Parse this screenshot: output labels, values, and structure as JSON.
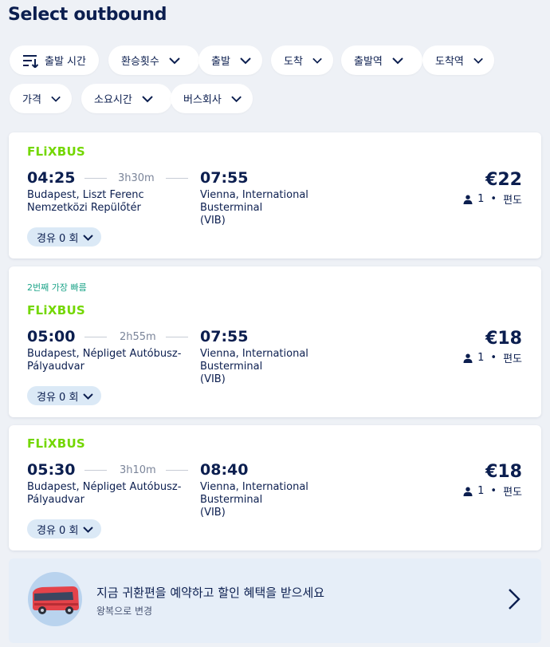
{
  "header": {
    "title": "Select outbound"
  },
  "filters": [
    {
      "label": "출발 시간"
    },
    {
      "label": "환승횟수"
    },
    {
      "label": "출발"
    },
    {
      "label": "도착"
    },
    {
      "label": "출발역"
    },
    {
      "label": "도착역"
    },
    {
      "label": "가격"
    },
    {
      "label": "소요시간"
    },
    {
      "label": "버스회사"
    }
  ],
  "results": [
    {
      "operator": "FLiXBUS",
      "tag": "",
      "depart_time": "04:25",
      "duration": "3h30m",
      "arrive_time": "07:55",
      "from_line1": "Budapest, Liszt Ferenc",
      "from_line2": "Nemzetközi Repülőtér",
      "to_line1": "Vienna, International Busterminal",
      "to_line2": "(VIB)",
      "price": "€22",
      "passengers": "1",
      "trip_type": "편도",
      "stops_label": "경유 0 회"
    },
    {
      "operator": "FLiXBUS",
      "tag": "2번째 가장 빠름",
      "depart_time": "05:00",
      "duration": "2h55m",
      "arrive_time": "07:55",
      "from_line1": "Budapest, Népliget Autóbusz-",
      "from_line2": "Pályaudvar",
      "to_line1": "Vienna, International Busterminal",
      "to_line2": "(VIB)",
      "price": "€18",
      "passengers": "1",
      "trip_type": "편도",
      "stops_label": "경유 0 회"
    },
    {
      "operator": "FLiXBUS",
      "tag": "",
      "depart_time": "05:30",
      "duration": "3h10m",
      "arrive_time": "08:40",
      "from_line1": "Budapest, Népliget Autóbusz-",
      "from_line2": "Pályaudvar",
      "to_line1": "Vienna, International Busterminal",
      "to_line2": "(VIB)",
      "price": "€18",
      "passengers": "1",
      "trip_type": "편도",
      "stops_label": "경유 0 회"
    }
  ],
  "promo": {
    "title": "지금 귀환편을 예약하고 할인 혜택을 받으세요",
    "subtitle": "왕복으로 변경"
  },
  "colors": {
    "brand_green": "#73d700",
    "navy": "#0b1e4f",
    "fast_tag": "#1fa58a",
    "stops_pill": "#dbe9f6",
    "background": "#eef1f6"
  }
}
